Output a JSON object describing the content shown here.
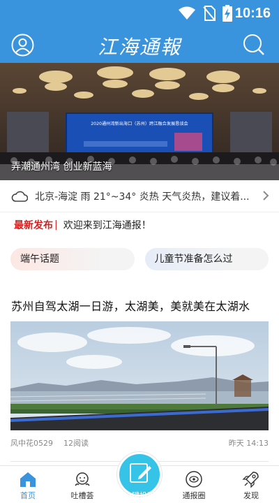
{
  "status_bar": {
    "time": "10:16",
    "icons": [
      "wifi-icon",
      "no-sim-icon",
      "battery-charging-icon"
    ]
  },
  "header": {
    "title": "江海通報",
    "left_icon": "user-avatar-icon",
    "right_icon": "search-icon",
    "color": "#3a93dd"
  },
  "banner": {
    "caption": "弄潮通州湾 创业新蓝海",
    "screen_text": "2020通州湾新出海口（苏州）跨江融合发展恳谈会"
  },
  "weather": {
    "icon": "cloud-icon",
    "text": "北京-海淀 雨 21°~34° 炎热 天气炎热，建议着..."
  },
  "notice": {
    "tag": "最新发布",
    "separator": "|",
    "message": "欢迎来到江海通报！",
    "tag_color": "#d81e1e"
  },
  "topics": [
    {
      "label": "端午话题"
    },
    {
      "label": "儿童节准备怎么过"
    }
  ],
  "article": {
    "title": "苏州自驾太湖一日游，太湖美，美就美在太湖水",
    "author": "风中花0529",
    "reads": "12阅读",
    "time": "昨天 14:13"
  },
  "bottom_nav": {
    "items": [
      {
        "label": "首页",
        "icon": "home-icon",
        "active": true
      },
      {
        "label": "吐槽荟",
        "icon": "chat-face-icon",
        "active": false
      },
      {
        "label": "一键投诉",
        "icon": "edit-icon",
        "active": false
      },
      {
        "label": "通报圈",
        "icon": "eye-circle-icon",
        "active": false
      },
      {
        "label": "发现",
        "icon": "rocket-icon",
        "active": false
      }
    ],
    "active_color": "#3a93dd",
    "center_color": "#35c3e8"
  }
}
